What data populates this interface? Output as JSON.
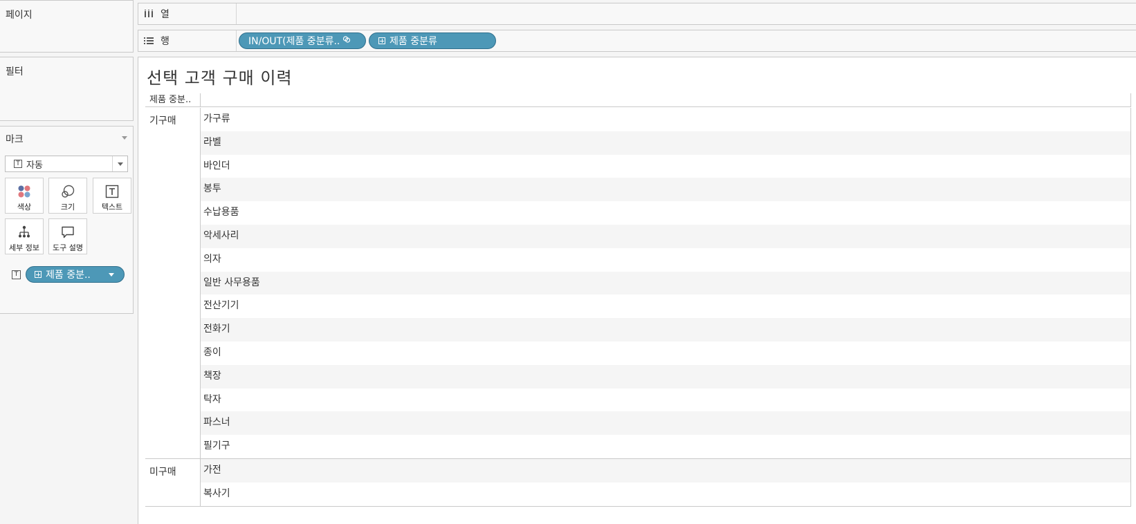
{
  "left_panel": {
    "pages_title": "페이지",
    "filters_title": "필터",
    "marks": {
      "title": "마크",
      "mark_type": "자동",
      "buttons": [
        {
          "label": "색상",
          "icon": "color-icon"
        },
        {
          "label": "크기",
          "icon": "size-icon"
        },
        {
          "label": "텍스트",
          "icon": "text-icon"
        },
        {
          "label": "세부 정보",
          "icon": "detail-icon"
        },
        {
          "label": "도구 설명",
          "icon": "tooltip-icon"
        }
      ],
      "text_pill": "제품 중분.."
    }
  },
  "shelves": {
    "columns_label": "열",
    "rows_label": "행",
    "row_pills": [
      "IN/OUT(제품 중분류..",
      "제품 중분류"
    ]
  },
  "view": {
    "title": "선택 고객 구매 이력",
    "header": "제품 중분..",
    "groups": [
      {
        "label": "기구매",
        "items": [
          "가구류",
          "라벨",
          "바인더",
          "봉투",
          "수납용품",
          "악세사리",
          "의자",
          "일반 사무용품",
          "전산기기",
          "전화기",
          "종이",
          "책장",
          "탁자",
          "파스너",
          "필기구"
        ]
      },
      {
        "label": "미구매",
        "items": [
          "가전",
          "복사기"
        ]
      }
    ]
  },
  "colors": {
    "pill_fill": "#4d98b7",
    "pill_border": "#2f6f8c",
    "row_alt": "#f5f5f5"
  }
}
